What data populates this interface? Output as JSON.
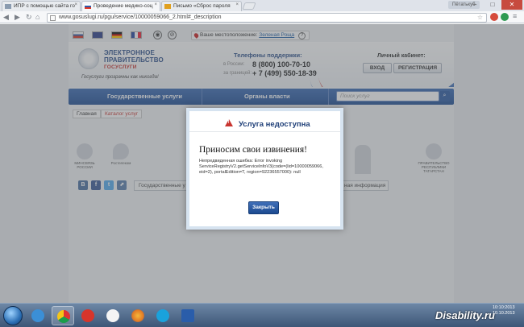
{
  "browser": {
    "tabs": [
      {
        "title": "ИПР с помощью сайта го",
        "favicon_color": "#8a9bb0"
      },
      {
        "title": "Проведение медико-соц",
        "favicon_color": "#3059a8"
      },
      {
        "title": "Письмо «Сброс пароля",
        "favicon_color": "#e0a020"
      }
    ],
    "user_badge": "Пётатькуб",
    "url": "www.gosuslugi.ru/pgu/service/10000059066_2.html#_description",
    "window_controls": {
      "minimize": "–",
      "maximize": "□",
      "close": "✕"
    }
  },
  "site": {
    "location_label": "Ваше местоположение:",
    "location_city": "Зеленая Роща",
    "logo": {
      "line1": "ЭЛЕКТРОННОЕ",
      "line2": "ПРАВИТЕЛЬСТВО",
      "line3": "ГОСУСЛУГИ"
    },
    "tagline": "Госуслуги прозрачны как никогда!",
    "support": {
      "title": "Телефоны поддержки:",
      "russia_label": "в России:",
      "russia_phone": "8 (800) 100-70-10",
      "abroad_label": "за границей:",
      "abroad_phone": "+ 7 (499) 550-18-39"
    },
    "cabinet": {
      "title": "Личный кабинет:",
      "login": "ВХОД",
      "register": "РЕГИСТРАЦИЯ"
    },
    "nav": {
      "services": "Государственные услуги",
      "authorities": "Органы власти",
      "search_placeholder": "Поиск услуг"
    },
    "breadcrumbs": {
      "home": "Главная",
      "current": "Каталог услуг"
    },
    "partners": [
      {
        "name": "МИНСВЯЗЬ РОССИИ"
      },
      {
        "name": "Ростелеком"
      },
      {
        "name": "ПРАВИТЕЛЬСТВО РЕСПУБЛИКИ ТАТАРСТАН"
      }
    ],
    "social": [
      {
        "glyph": "B",
        "color": "#4a6fa0"
      },
      {
        "glyph": "f",
        "color": "#3b5998"
      },
      {
        "glyph": "t",
        "color": "#55acee"
      },
      {
        "glyph": "⬈",
        "color": "#5a7fae"
      }
    ],
    "bottom_tabs": {
      "left": "Государственные у",
      "right": "ная информация"
    }
  },
  "modal": {
    "title": "Услуга недоступна",
    "apology": "Приносим свои извинения!",
    "error": "Непредвиденная ошибка: Error invoking ServiceRegistryV2.getServiceInfoV3(code=(lid=10000059066, eid=2), portalEdition=T, region=92236557000): null",
    "close_button": "Закрыть"
  },
  "taskbar": {
    "brand": "Disability.ru",
    "clock_line1": "10:10:2013",
    "clock_line2": "10.10.2013",
    "apps": [
      {
        "name": "ie",
        "color": "#3b8fd6"
      },
      {
        "name": "chrome",
        "color": "#e0b531"
      },
      {
        "name": "yandex",
        "color": "#d7352b"
      },
      {
        "name": "cloud",
        "color": "#ffffff"
      },
      {
        "name": "firefox",
        "color": "#e27b26"
      },
      {
        "name": "skype",
        "color": "#1aa2dc"
      },
      {
        "name": "word",
        "color": "#2a5daa"
      }
    ]
  }
}
